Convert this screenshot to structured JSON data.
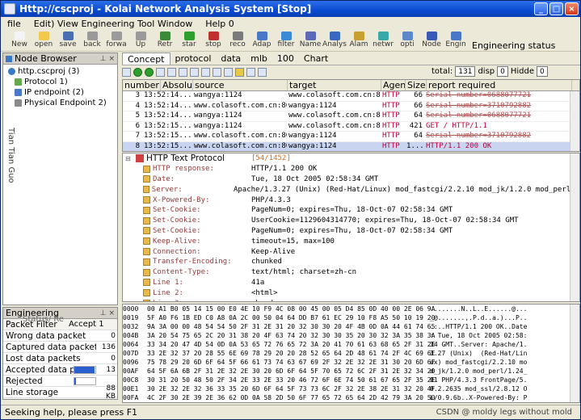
{
  "window": {
    "title": "Http://cscproj - Kolai Network Analysis System [Stop]"
  },
  "menu": [
    "file",
    "Edit) View Engineering Tool Window",
    "Help 0"
  ],
  "toolbar": [
    {
      "label": "New",
      "color": "#f4f4f4"
    },
    {
      "label": "open",
      "color": "#f2c94c"
    },
    {
      "label": "save",
      "color": "#4a6fb0"
    },
    {
      "label": "back",
      "color": "#9a9a9a"
    },
    {
      "label": "forwa",
      "color": "#9a9a9a"
    },
    {
      "label": "Up",
      "color": "#9a9a9a"
    },
    {
      "label": "Retr",
      "color": "#3a8a3a"
    },
    {
      "label": "star",
      "color": "#2e9f2e"
    },
    {
      "label": "stop",
      "color": "#c03030"
    },
    {
      "label": "reco",
      "color": "#7a7a7a"
    },
    {
      "label": "Adap",
      "color": "#4a78c8"
    },
    {
      "label": "filter",
      "color": "#3a8ad8"
    },
    {
      "label": "Name",
      "color": "#5a6ab8"
    },
    {
      "label": "Analys",
      "color": "#3a68c0"
    },
    {
      "label": "Alam",
      "color": "#c8a030"
    },
    {
      "label": "netwr",
      "color": "#3aa8a8"
    },
    {
      "label": "opti",
      "color": "#5a88c8"
    },
    {
      "label": "Node",
      "color": "#3a58b8"
    },
    {
      "label": "Engin",
      "color": "#4a78c8"
    }
  ],
  "engineering_status_label": "Engineering status",
  "node_browser": {
    "title": "Node Browser",
    "items": [
      {
        "label": "http.cscproj (3)"
      },
      {
        "label": "Protocol 1)"
      },
      {
        "label": "IP endpoint (2)"
      },
      {
        "label": "Physical Endpoint 2)"
      }
    ],
    "side_text": "Tian Tian Guo"
  },
  "engineering": {
    "title": "Engineering",
    "overlay_text": "Status/ Re",
    "header": {
      "left": "Packet Filter",
      "right": "Accept 1"
    },
    "rows": [
      {
        "label": "Wrong data packet",
        "value": "0",
        "bar": null
      },
      {
        "label": "Captured data packets",
        "value": "136",
        "bar": null
      },
      {
        "label": "Lost data packets",
        "value": "0",
        "bar": null
      },
      {
        "label": "Accepted data packets",
        "value": "13",
        "bar": 0.95
      },
      {
        "label": "Rejected",
        "value": "",
        "bar": 0.08
      },
      {
        "label": "Line storage",
        "value": "88 KB",
        "bar": null
      }
    ]
  },
  "tabs": [
    "Concept",
    "protocol",
    "data",
    "mlb",
    "100",
    "Chart"
  ],
  "total": {
    "label": "total:",
    "count": "131",
    "disp_label": "disp",
    "disp": "0",
    "hidden_label": "Hidde",
    "hidden": "0"
  },
  "packets": {
    "columns": [
      "number",
      "Absolu",
      "source",
      "target",
      "Agen",
      "Size",
      "report required"
    ],
    "rows": [
      {
        "no": "3",
        "time": "13:52:14...",
        "src": "wangya:1124",
        "dst": "www.colasoft.com.cn:80",
        "proto": "HTTP",
        "size": "66",
        "summary": "Serial number=0688077721",
        "style": "strike",
        "sel": false
      },
      {
        "no": "4",
        "time": "13:52:14...",
        "src": "www.colasoft.com.cn:80",
        "dst": "wangya:1124",
        "proto": "HTTP",
        "size": "66",
        "summary": "Serial number=3710792882",
        "style": "strike",
        "sel": false
      },
      {
        "no": "5",
        "time": "13:52:14...",
        "src": "wangya:1124",
        "dst": "www.colasoft.com.cn:80",
        "proto": "HTTP",
        "size": "64",
        "summary": "Serial number=0688077721",
        "style": "strike",
        "sel": false
      },
      {
        "no": "6",
        "time": "13:52:15...",
        "src": "wangya:1124",
        "dst": "www.colasoft.com.cn:80",
        "proto": "HTTP",
        "size": "421",
        "summary": "GET / HTTP/1.1",
        "style": "red",
        "sel": false
      },
      {
        "no": "7",
        "time": "13:52:15...",
        "src": "www.colasoft.com.cn:80",
        "dst": "wangya:1124",
        "proto": "HTTP",
        "size": "64",
        "summary": "Serial number=3710792882",
        "style": "strike",
        "sel": false
      },
      {
        "no": "8",
        "time": "13:52:15...",
        "src": "www.colasoft.com.cn:80",
        "dst": "wangya:1124",
        "proto": "HTTP",
        "size": "1...",
        "summary": "HTTP/1.1 200 OK",
        "style": "red",
        "sel": true
      }
    ]
  },
  "decode": {
    "header": {
      "label": "HTTP Text Protocol",
      "range": "[54/1452]"
    },
    "rows": [
      {
        "name": "HTTP response:",
        "value": "HTTP/1.1 200 OK"
      },
      {
        "name": "Date:",
        "value": "Tue, 18 Oct 2005 02:58:34 GMT"
      },
      {
        "name": "Server:",
        "value": "Apache/1.3.27 (Unix)  (Red-Hat/Linux) mod_fastcgi/2.2.10 mod_jk/1.2.0 mod_perl/1"
      },
      {
        "name": "X-Powered-By:",
        "value": "PHP/4.3.3"
      },
      {
        "name": "Set-Cookie:",
        "value": "PageNum=0; expires=Thu, 18-Oct-07 02:58:34 GMT"
      },
      {
        "name": "Set-Cookie:",
        "value": "UserCookie=1129604314770; expires=Thu, 18-Oct-07 02:58:34 GMT"
      },
      {
        "name": "Set-Cookie:",
        "value": "PageNum=0; expires=Thu, 18-Oct-07 02:58:34 GMT"
      },
      {
        "name": "Keep-Alive:",
        "value": "timeout=15, max=100"
      },
      {
        "name": "Connection:",
        "value": "Keep-Alive"
      },
      {
        "name": "Transfer-Encoding:",
        "value": "chunked"
      },
      {
        "name": "Content-Type:",
        "value": "text/html; charset=zh-cn"
      },
      {
        "name": "Line 1:",
        "value": "41a"
      },
      {
        "name": "Line 2:",
        "value": "<html>"
      },
      {
        "name": "Line 3:",
        "value": "<head>"
      }
    ]
  },
  "hex": [
    {
      "off": "0000",
      "bytes": "00 A1 B0 05 14 15 00 E0 4E 10 F9 4C 08 00 45 00 05 D4 85 0D 40 00 2E 06 9A",
      "ascii": "........N..L..E......@..."
    },
    {
      "off": "0019",
      "bytes": "5F A0 F6 1B ED C0 A8 0A 2C 00 50 04 64 DD B7 61 EC 29 10 F8 A5 50 10 19 20",
      "ascii": "_@.......,.P.d..a.)...P.."
    },
    {
      "off": "0032",
      "bytes": "9A 3A 00 00 48 54 54 50 2F 31 2E 31 20 32 30 30 20 4F 4B 0D 0A 44 61 74 65",
      "ascii": ".:..HTTP/1.1 200 OK..Date"
    },
    {
      "off": "004B",
      "bytes": "3A 20 54 75 65 2C 20 31 38 20 4F 63 74 20 32 30 30 35 20 30 32 3A 35 38 3A",
      "ascii": ": Tue, 18 Oct 2005 02:58:"
    },
    {
      "off": "0064",
      "bytes": "33 34 20 47 4D 54 0D 0A 53 65 72 76 65 72 3A 20 41 70 61 63 68 65 2F 31 2E",
      "ascii": "34 GMT..Server: Apache/1."
    },
    {
      "off": "007D",
      "bytes": "33 2E 32 37 20 28 55 6E 69 78 29 20 20 28 52 65 64 2D 48 61 74 2F 4C 69 6E",
      "ascii": "3.27 (Unix)  (Red-Hat/Lin"
    },
    {
      "off": "0096",
      "bytes": "75 78 29 20 6D 6F 64 5F 66 61 73 74 63 67 69 2F 32 2E 32 2E 31 30 20 6D 6F",
      "ascii": "ux) mod_fastcgi/2.2.10 mo"
    },
    {
      "off": "00AF",
      "bytes": "64 5F 6A 6B 2F 31 2E 32 2E 30 20 6D 6F 64 5F 70 65 72 6C 2F 31 2E 32 34 20",
      "ascii": "d_jk/1.2.0 mod_perl/1.24_"
    },
    {
      "off": "00C8",
      "bytes": "30 31 20 50 48 50 2F 34 2E 33 2E 33 20 46 72 6F 6E 74 50 61 67 65 2F 35 2E",
      "ascii": "01 PHP/4.3.3 FrontPage/5."
    },
    {
      "off": "00E1",
      "bytes": "30 2E 32 2E 32 36 33 35 20 6D 6F 64 5F 73 73 6C 2F 32 2E 38 2E 31 32 20 4F",
      "ascii": "0.2.2635 mod_ssl/2.8.12 O"
    },
    {
      "off": "00FA",
      "bytes": "4C 2F 30 2E 39 2E 36 62 0D 0A 58 2D 50 6F 77 65 72 65 64 2D 42 79 3A 20 50",
      "ascii": "L/0.9.6b..X-Powered-By: P"
    }
  ],
  "status": {
    "text": "Seeking help, please press F1",
    "watermark": "CSDN @ moldy legs without mold"
  }
}
